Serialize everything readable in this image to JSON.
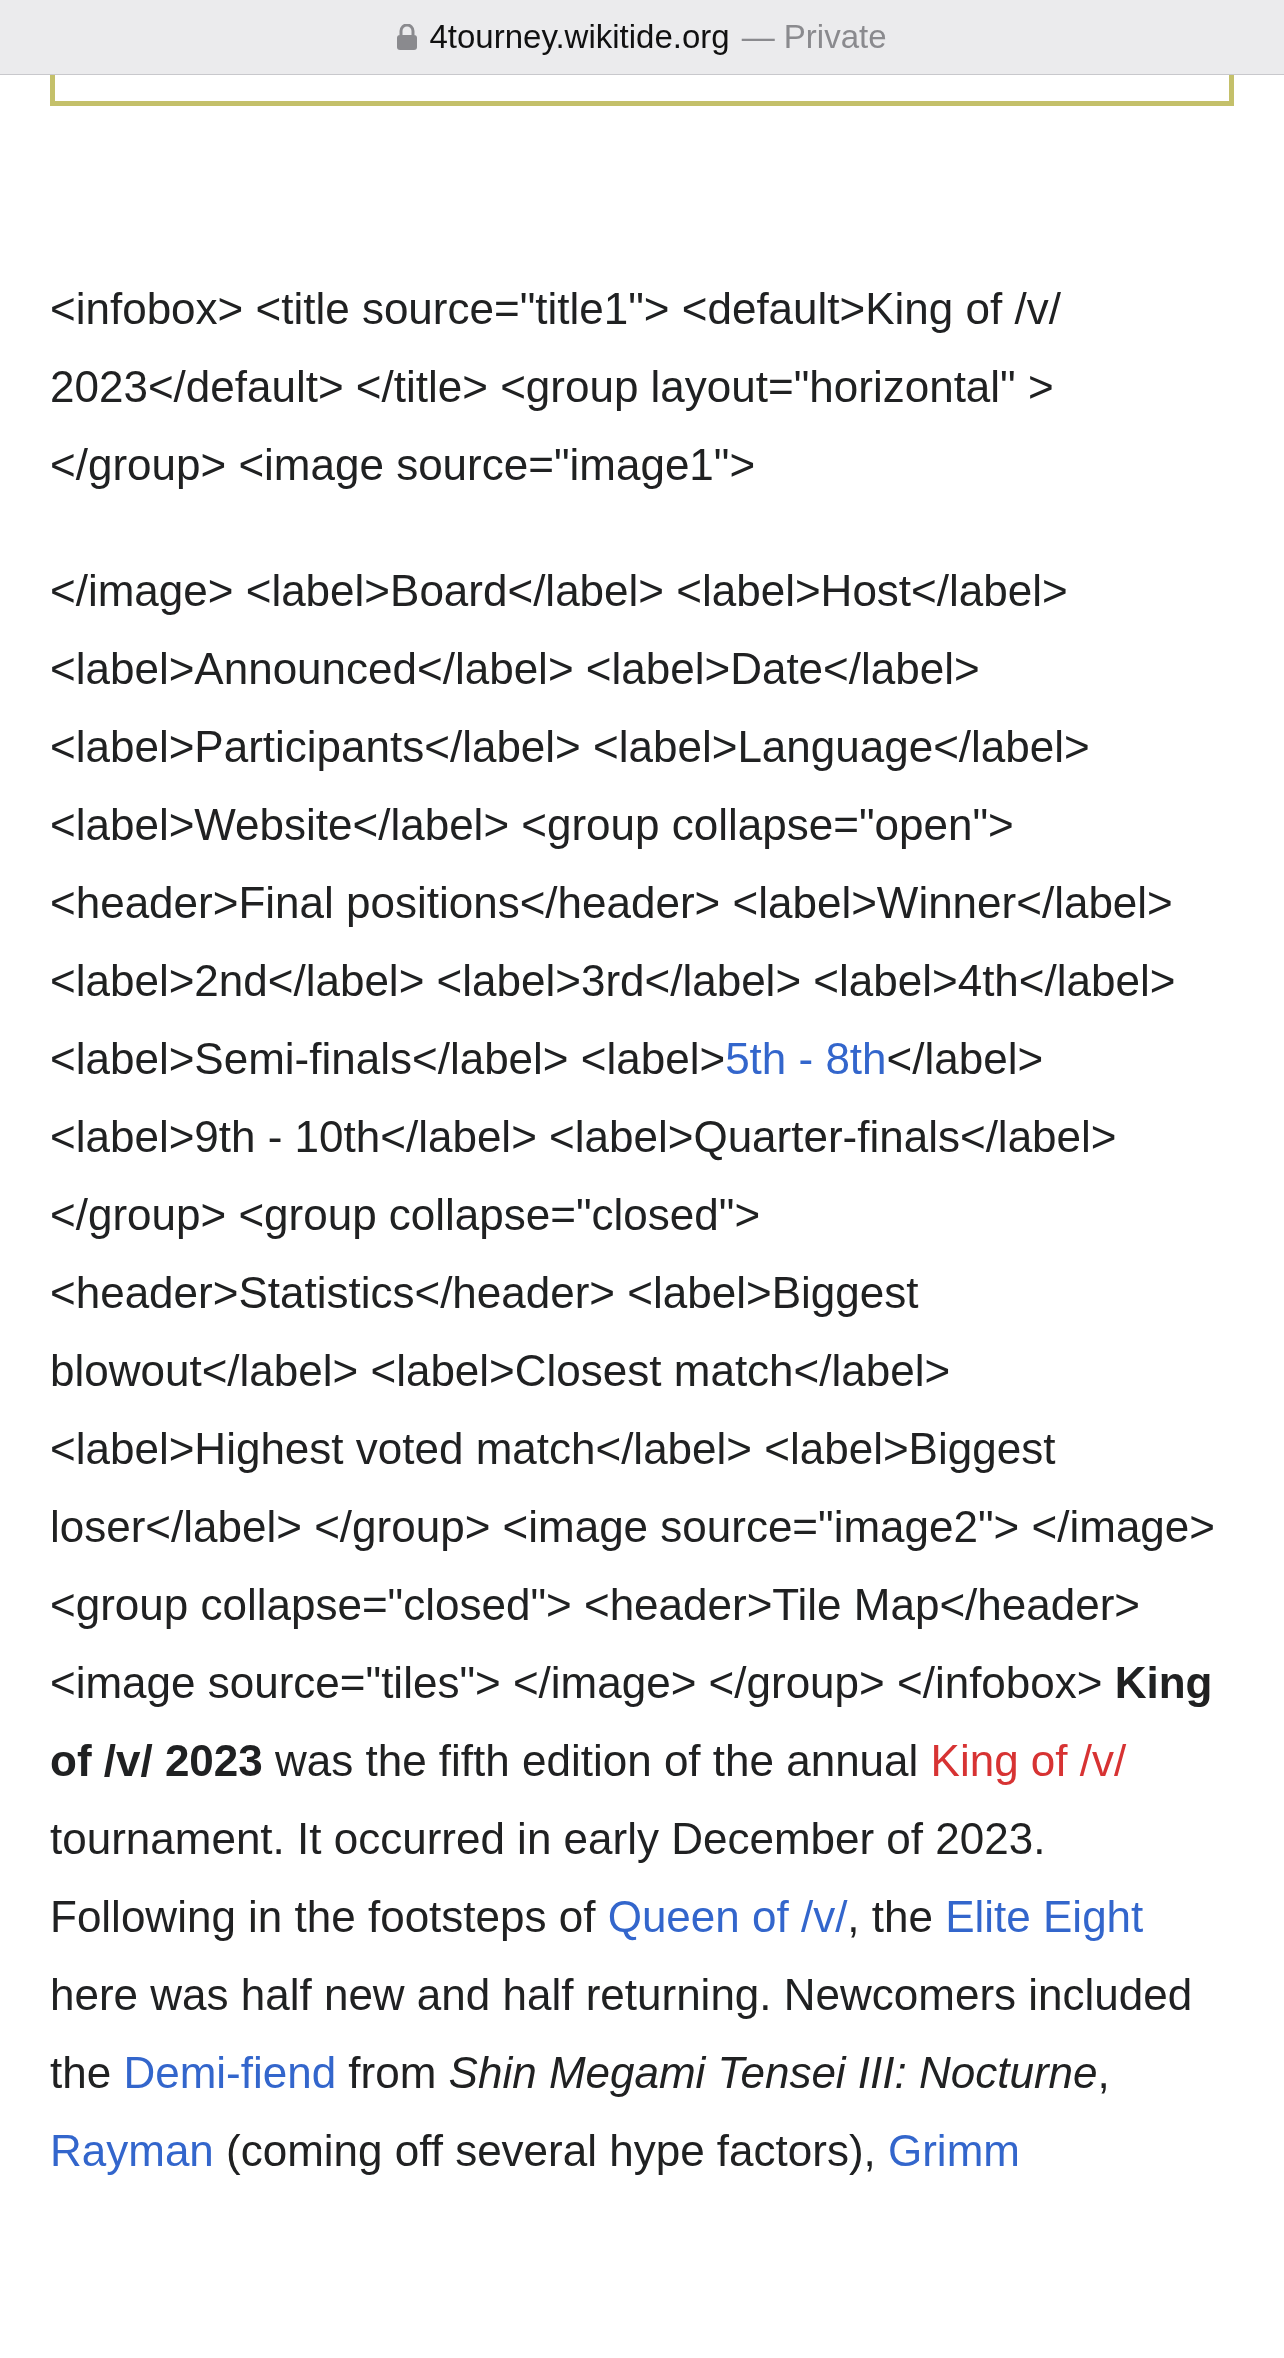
{
  "address_bar": {
    "domain": "4tourney.wikitide.org",
    "mode": "— Private"
  },
  "paragraphs": [
    [
      {
        "kind": "plain",
        "text": "<infobox> <title source=\"title1\"> <default>King of /v/ 2023</default> </title> <group layout=\"horizontal\" > </group> <image source=\"image1\">"
      }
    ],
    [
      {
        "kind": "plain",
        "text": "</image> <label>Board</label> <label>Host</label> <label>Announced</label> <label>Date</label> <label>Participants</label> <label>Language</label> <label>Website</label> <group collapse=\"open\"> <header>Final positions</header> <label>Winner</label> <label>2nd</label> <label>3rd</label> <label>4th</label> <label>Semi-finals</label> <label>"
      },
      {
        "kind": "link",
        "text": "5th - 8th"
      },
      {
        "kind": "plain",
        "text": "</label> <label>9th - 10th</label> <label>Quarter-finals</label> </group> <group collapse=\"closed\"> <header>Statistics</header> <label>Biggest blowout</label> <label>Closest match</label> <label>Highest voted match</label> <label>Biggest loser</label> </group> <image source=\"image2\"> </image> <group collapse=\"closed\"> <header>Tile Map</header> <image source=\"tiles\"> </image> </group> </infobox> "
      },
      {
        "kind": "bold",
        "text": "King of /v/ 2023"
      },
      {
        "kind": "plain",
        "text": " was the fifth edition of the annual "
      },
      {
        "kind": "redlink",
        "text": "King of /v/"
      },
      {
        "kind": "plain",
        "text": " tournament. It occurred in early December of 2023. Following in the footsteps of "
      },
      {
        "kind": "link",
        "text": "Queen of /v/"
      },
      {
        "kind": "plain",
        "text": ", the "
      },
      {
        "kind": "link",
        "text": "Elite Eight"
      },
      {
        "kind": "plain",
        "text": " here was half new and half returning. Newcomers included the "
      },
      {
        "kind": "link",
        "text": "Demi-fiend"
      },
      {
        "kind": "plain",
        "text": " from "
      },
      {
        "kind": "italic",
        "text": "Shin Megami Tensei III: Nocturne"
      },
      {
        "kind": "plain",
        "text": ", "
      },
      {
        "kind": "link",
        "text": "Rayman"
      },
      {
        "kind": "plain",
        "text": " (coming off several hype factors), "
      },
      {
        "kind": "link",
        "text": "Grimm"
      }
    ]
  ]
}
